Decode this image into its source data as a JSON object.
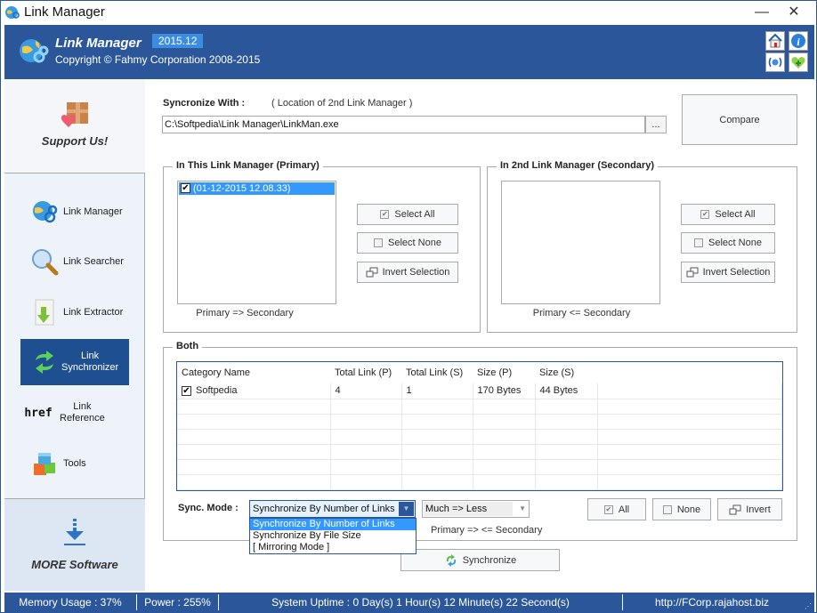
{
  "window": {
    "title": "Link Manager",
    "minimize_label": "—",
    "close_label": "✕"
  },
  "header": {
    "app_name": "Link Manager",
    "version": "2015.12",
    "copyright": "Copyright © Fahmy Corporation 2008-2015",
    "icons": [
      "home-icon",
      "info-icon",
      "wireless-icon",
      "favorite-heart-icon"
    ]
  },
  "sidebar": {
    "support_label": "Support Us!",
    "items": [
      {
        "label": "Link Manager",
        "icon": "link-manager-icon",
        "active": false
      },
      {
        "label": "Link Searcher",
        "icon": "magnifier-icon",
        "active": false
      },
      {
        "label": "Link Extractor",
        "icon": "extract-icon",
        "active": false
      },
      {
        "label_line1": "Link",
        "label_line2": "Synchronizer",
        "icon": "sync-icon",
        "active": true
      },
      {
        "label_line1": "Link",
        "label_line2": "Reference",
        "icon_text": "href",
        "icon": "href-icon",
        "active": false
      },
      {
        "label": "Tools",
        "icon": "tools-cubes-icon",
        "active": false
      }
    ],
    "more_label": "MORE Software"
  },
  "sync_with": {
    "label": "Syncronize With :",
    "hint": "( Location of 2nd Link Manager )",
    "path_value": "C:\\Softpedia\\Link Manager\\LinkMan.exe",
    "browse_label": "...",
    "compare_label": "Compare"
  },
  "primary": {
    "title": "In This Link Manager (Primary)",
    "items": [
      {
        "label": "(01-12-2015 12.08.33)",
        "checked": true,
        "selected": true
      }
    ],
    "caption": "Primary => Secondary",
    "select_all": "Select All",
    "select_none": "Select None",
    "invert": "Invert Selection"
  },
  "secondary": {
    "title": "In 2nd Link Manager (Secondary)",
    "items": [],
    "caption": "Primary <= Secondary",
    "select_all": "Select All",
    "select_none": "Select None",
    "invert": "Invert Selection"
  },
  "both": {
    "title": "Both",
    "columns": [
      "Category Name",
      "Total Link (P)",
      "Total Link (S)",
      "Size (P)",
      "Size (S)"
    ],
    "rows": [
      {
        "checked": true,
        "cells": [
          "Softpedia",
          "4",
          "1",
          "170 Bytes",
          "44 Bytes"
        ]
      }
    ],
    "sync_mode_label": "Sync. Mode :",
    "sync_mode_value": "Synchronize By Number of Links",
    "sync_mode_options": [
      "Synchronize By Number of Links",
      "Synchronize By File Size",
      "[ Mirroring Mode ]"
    ],
    "direction_value": "Much => Less",
    "direction_caption": "Primary => <= Secondary",
    "all_label": "All",
    "none_label": "None",
    "invert_label": "Invert",
    "synchronize_label": "Synchronize"
  },
  "statusbar": {
    "memory": "Memory Usage : 37%",
    "power": "Power : 255%",
    "uptime": "System Uptime : 0 Day(s) 1 Hour(s) 12 Minute(s) 22 Second(s)",
    "url": "http://FCorp.rajahost.biz"
  }
}
